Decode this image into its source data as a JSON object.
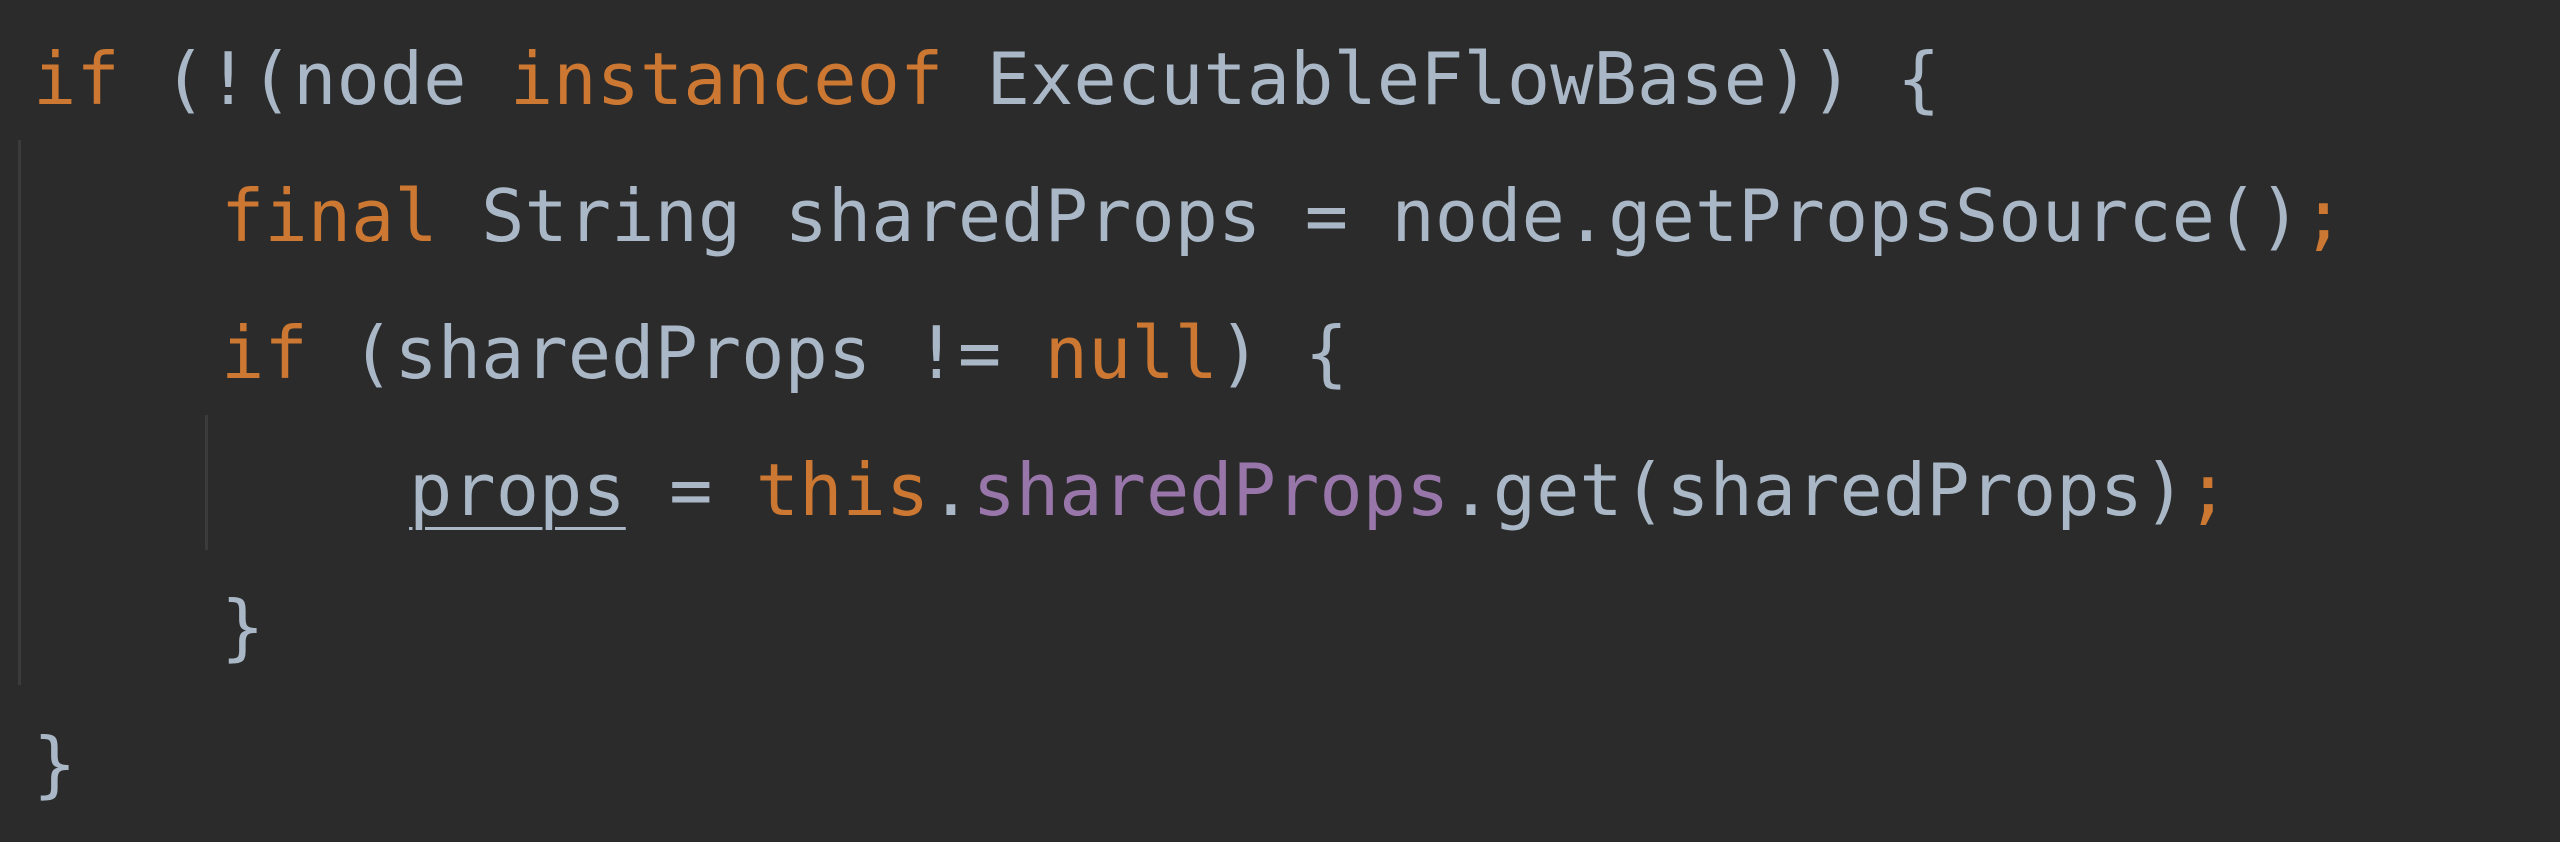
{
  "editor": {
    "colors": {
      "background": "#2b2b2b",
      "keyword": "#cc7832",
      "plain": "#a9b7c6",
      "field": "#9876aa",
      "indent_guide": "#3b3b3b"
    },
    "lines": [
      {
        "indent": 0,
        "tokens": [
          {
            "text": "if",
            "kind": "keyword"
          },
          {
            "text": " (!(node ",
            "kind": "plain"
          },
          {
            "text": "instanceof",
            "kind": "keyword"
          },
          {
            "text": " ExecutableFlowBase)) {",
            "kind": "plain"
          }
        ]
      },
      {
        "indent": 1,
        "tokens": [
          {
            "text": "final",
            "kind": "keyword"
          },
          {
            "text": " String sharedProps = node.getPropsSource()",
            "kind": "plain"
          },
          {
            "text": ";",
            "kind": "keyword"
          }
        ]
      },
      {
        "indent": 1,
        "tokens": [
          {
            "text": "if",
            "kind": "keyword"
          },
          {
            "text": " (sharedProps != ",
            "kind": "plain"
          },
          {
            "text": "null",
            "kind": "keyword"
          },
          {
            "text": ") {",
            "kind": "plain"
          }
        ]
      },
      {
        "indent": 2,
        "tokens": [
          {
            "text": "props",
            "kind": "underlined"
          },
          {
            "text": " = ",
            "kind": "plain"
          },
          {
            "text": "this",
            "kind": "keyword"
          },
          {
            "text": ".",
            "kind": "plain"
          },
          {
            "text": "sharedProps",
            "kind": "field"
          },
          {
            "text": ".get(sharedProps)",
            "kind": "plain"
          },
          {
            "text": ";",
            "kind": "keyword"
          }
        ]
      },
      {
        "indent": 1,
        "tokens": [
          {
            "text": "}",
            "kind": "plain"
          }
        ]
      },
      {
        "indent": 0,
        "tokens": [
          {
            "text": "}",
            "kind": "plain"
          }
        ]
      }
    ]
  }
}
